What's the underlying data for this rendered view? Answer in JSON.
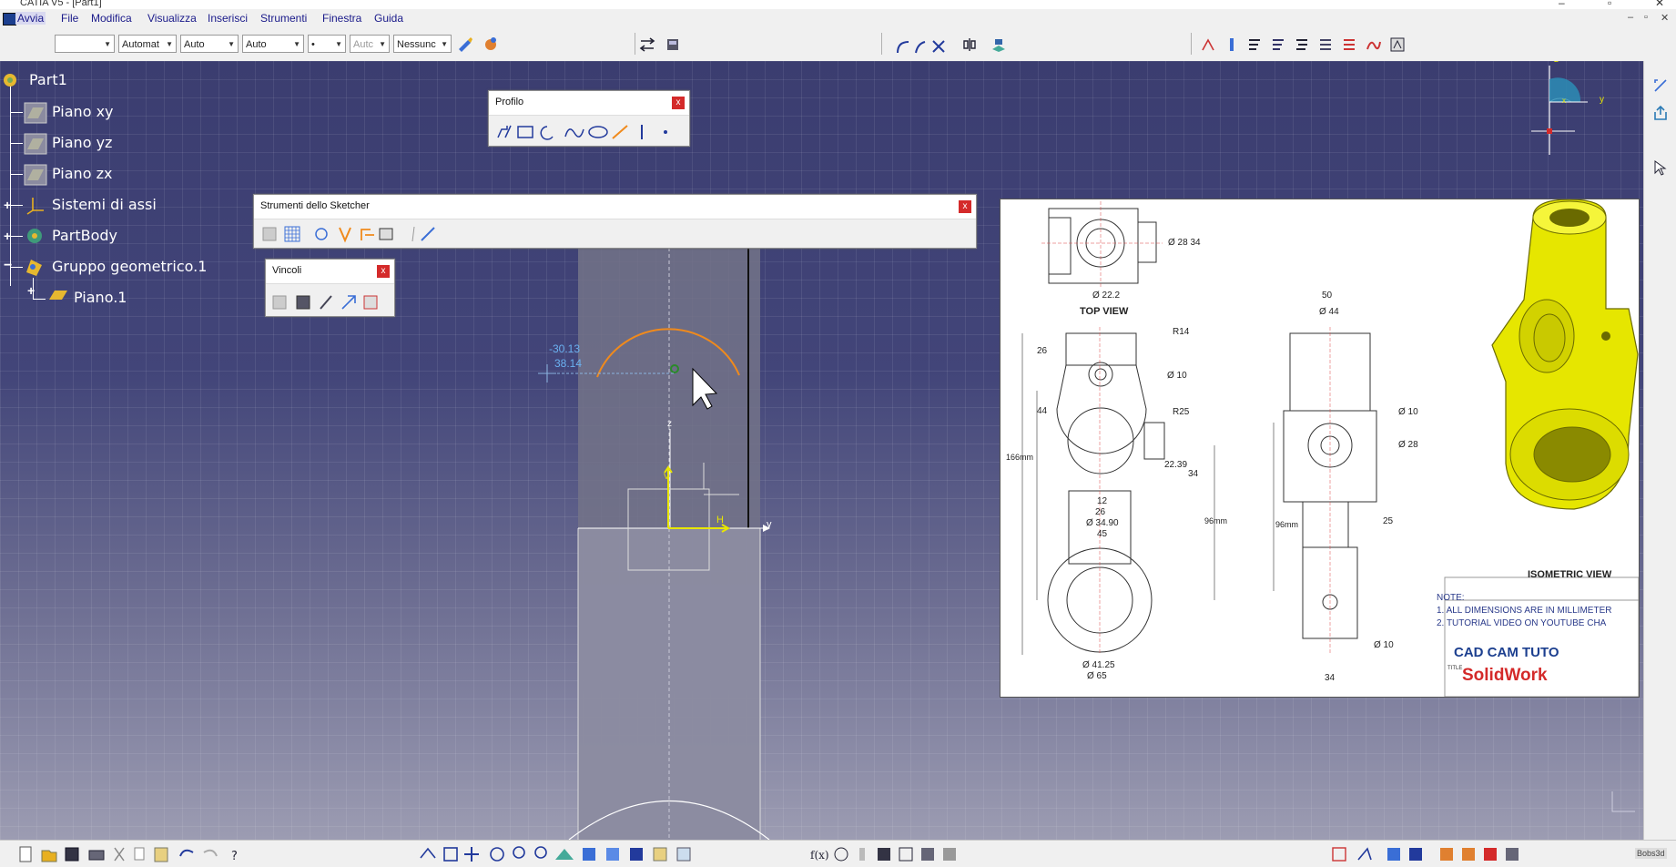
{
  "window": {
    "title": "CATIA V5 - [Part1]"
  },
  "menu": {
    "items": [
      "Avvia",
      "File",
      "Modifica",
      "Visualizza",
      "Inserisci",
      "Strumenti",
      "Finestra",
      "Guida"
    ]
  },
  "toolbar": {
    "combo_color": "",
    "combo_linetype": "Automat",
    "combo_thickness": "Auto",
    "combo_linestyle": "Auto",
    "combo_point": "•",
    "combo_layer": "Autc",
    "combo_filter": "Nessunc"
  },
  "tree": {
    "root": "Part1",
    "items": [
      "Piano xy",
      "Piano yz",
      "Piano zx",
      "Sistemi di assi",
      "PartBody",
      "Gruppo geometrico.1",
      "Piano.1"
    ]
  },
  "panels": {
    "profilo": {
      "title": "Profilo",
      "close": "x"
    },
    "sketcher": {
      "title": "Strumenti dello Sketcher",
      "close": "x"
    },
    "vincoli": {
      "title": "Vincoli",
      "close": "x"
    }
  },
  "sketch": {
    "coord_h": "-30.13",
    "coord_v": "38.14",
    "axis_z": "z",
    "axis_y": "y",
    "label_h": "H",
    "label_v": "V"
  },
  "compass": {
    "z": "z",
    "y": "y",
    "x": "x"
  },
  "drawing": {
    "top_view": "TOP VIEW",
    "iso_view": "ISOMETRIC VIEW",
    "dims": {
      "d28_34": "Ø 28 34",
      "d22_2": "Ø 22.2",
      "r14": "R14",
      "d10a": "Ø 10",
      "r25": "R25",
      "d26": "26",
      "d44": "44",
      "d166": "166mm",
      "d22_39": "22.39",
      "d34": "34",
      "d12": "12",
      "d26b": "26",
      "d34_90": "Ø 34.90",
      "d45": "45",
      "d96a": "96mm",
      "d41_25": "Ø 41.25",
      "d65": "Ø 65",
      "d50": "50",
      "d44b": "Ø 44",
      "d10b": "Ø 10",
      "d28": "Ø 28",
      "d96b": "96mm",
      "d25": "25",
      "d10c": "Ø 10",
      "d34b": "34"
    },
    "note_title": "NOTE:",
    "note_1": "1.   ALL DIMENSIONS ARE IN MILLIMETER",
    "note_2": "2.   TUTORIAL VIDEO ON YOUTUBE CHA",
    "brand_1": "CAD CAM TUTO",
    "brand_2": "SolidWork",
    "brand_small": "TITLE"
  },
  "bottom_right": "Bobs3d",
  "colors": {
    "accent": "#f08a1c",
    "close": "#d42a2a",
    "background": "#3d3f72",
    "part_yellow": "#e8e600"
  }
}
